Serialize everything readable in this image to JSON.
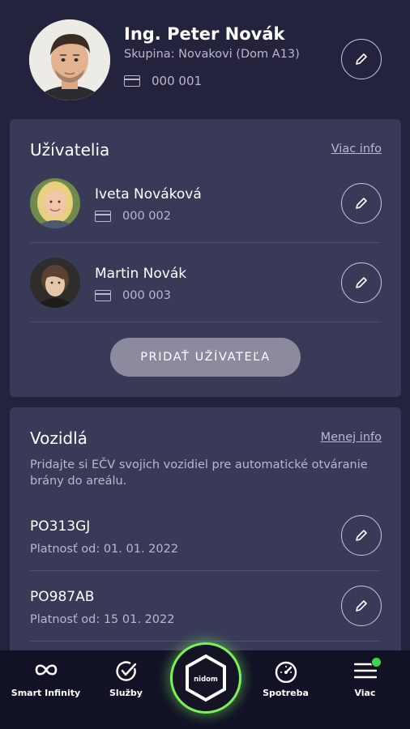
{
  "profile": {
    "name": "Ing. Peter Novák",
    "group": "Skupina: Novakovi (Dom A13)",
    "card_number": "000 001"
  },
  "users_section": {
    "title": "Užívatelia",
    "link": "Viac info",
    "users": [
      {
        "name": "Iveta Nováková",
        "card_number": "000 002"
      },
      {
        "name": "Martin Novák",
        "card_number": "000 003"
      }
    ],
    "add_button": "PRIDAŤ UŽÍVATEĽA"
  },
  "vehicles_section": {
    "title": "Vozidlá",
    "link": "Menej info",
    "description": "Pridajte si EČV svojich vozidiel pre automatické otváranie brány do areálu.",
    "vehicles": [
      {
        "plate": "PO313GJ",
        "valid": "Platnosť od: 01. 01. 2022"
      },
      {
        "plate": "PO987AB",
        "valid": "Platnosť od: 15 01. 2022"
      }
    ]
  },
  "bottom_nav": {
    "items": [
      {
        "label": "Smart Infinity",
        "icon": "infinity-icon"
      },
      {
        "label": "Služby",
        "icon": "check-circle-icon"
      },
      {
        "label": "",
        "icon": "nidom-logo-icon"
      },
      {
        "label": "Spotreba",
        "icon": "gauge-icon"
      },
      {
        "label": "Viac",
        "icon": "menu-icon"
      }
    ],
    "center_logo_text": "nidom"
  },
  "colors": {
    "background": "#23233d",
    "card": "#393a57",
    "nav": "#121226",
    "accent_green": "#7cf05a",
    "button_gray": "#8b8a9e"
  }
}
